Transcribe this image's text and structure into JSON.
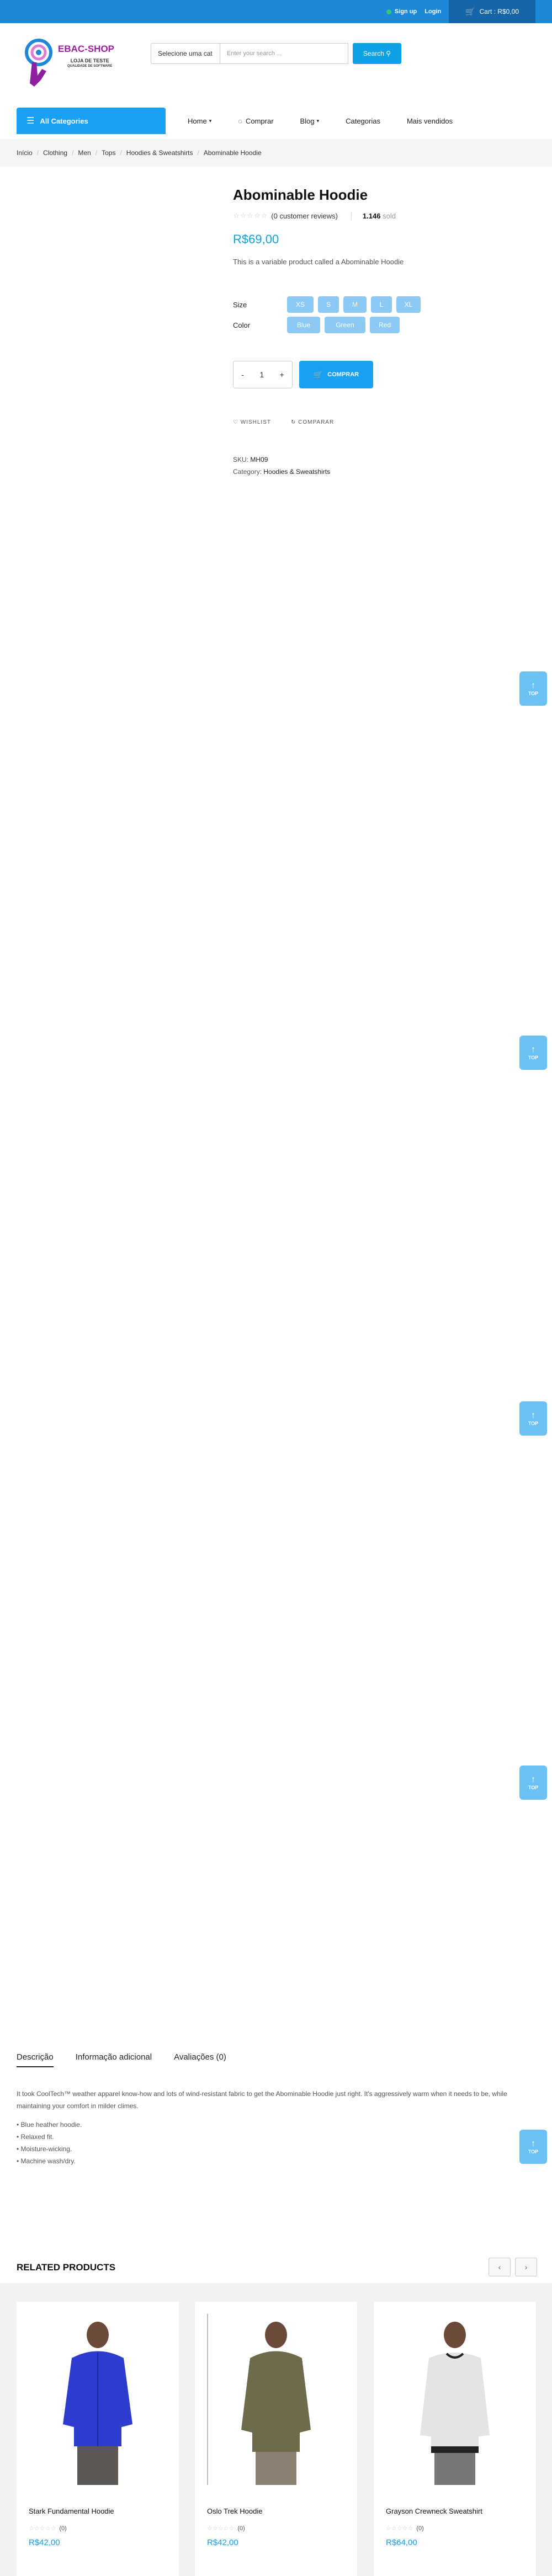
{
  "topbar": {
    "signup": "Sign up",
    "login": "Login",
    "cart": "Cart : R$0,00"
  },
  "logo": {
    "name": "EBAC-SHOP",
    "tagline1": "LOJA DE TESTE",
    "tagline2": "QUALIDADE DE SOFTWARE"
  },
  "search": {
    "category": "Selecione uma cat",
    "placeholder": "Enter your search ...",
    "button": "Search"
  },
  "nav": {
    "all_categories": "All Categories",
    "items": [
      "Home",
      "Comprar",
      "Blog",
      "Categorias",
      "Mais vendidos"
    ]
  },
  "breadcrumb": [
    "Início",
    "Clothing",
    "Men",
    "Tops",
    "Hoodies & Sweatshirts",
    "Abominable Hoodie"
  ],
  "product": {
    "title": "Abominable Hoodie",
    "reviews": "(0 customer reviews)",
    "sold_count": "1.146",
    "sold_label": "sold",
    "price": "R$69,00",
    "description": "This is a variable product called a Abominable Hoodie",
    "size_label": "Size",
    "sizes": [
      "XS",
      "S",
      "M",
      "L",
      "XL"
    ],
    "color_label": "Color",
    "colors": [
      "Blue",
      "Green",
      "Red"
    ],
    "quantity": "1",
    "buy_button": "COMPRAR",
    "wishlist": "WISHLIST",
    "compare": "COMPARAR",
    "sku_label": "SKU:",
    "sku": "MH09",
    "category_label": "Category:",
    "category": "Hoodies & Sweatshirts"
  },
  "totop_label": "TOP",
  "tabs": [
    "Descrição",
    "Informação adicional",
    "Avaliações (0)"
  ],
  "tab_description": {
    "text": "It took CoolTech™ weather apparel know-how and lots of wind-resistant fabric to get the Abominable Hoodie just right. It's aggressively warm when it needs to be, while maintaining your comfort in milder climes.",
    "bullets": [
      "• Blue heather hoodie.",
      "• Relaxed fit.",
      "• Moisture-wicking.",
      "• Machine wash/dry."
    ]
  },
  "related": {
    "title": "RELATED PRODUCTS",
    "products": [
      {
        "name": "Stark Fundamental Hoodie",
        "reviews": "(0)",
        "price": "R$42,00"
      },
      {
        "name": "Oslo Trek Hoodie",
        "reviews": "(0)",
        "price": "R$42,00"
      },
      {
        "name": "Grayson Crewneck Sweatshirt",
        "reviews": "(0)",
        "price": "R$64,00"
      }
    ]
  },
  "colors": {
    "primary": "#1aa0f2",
    "topbar": "#1e88d8",
    "price": "#0ea1e6",
    "option": "#8cc9f4",
    "brand": "#a01da0"
  }
}
